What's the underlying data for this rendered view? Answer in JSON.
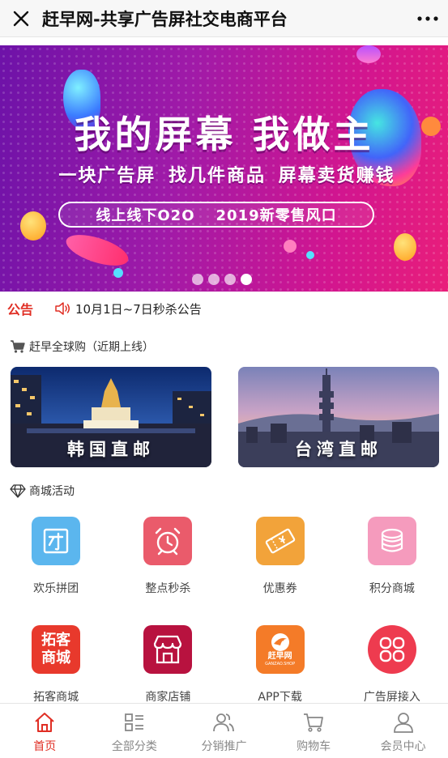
{
  "window": {
    "title": "赶早网-共享广告屏社交电商平台"
  },
  "banner": {
    "headline": "我的屏幕  我做主",
    "subline": "一块广告屏  找几件商品  屏幕卖货赚钱",
    "pill_left": "线上线下O2O",
    "pill_right": "2019新零售风口",
    "slide_count": 4,
    "active_slide": 4
  },
  "notice": {
    "label": "公告",
    "text": "10月1日~7日秒杀公告"
  },
  "global_buy": {
    "title": "赶早全球购（近期上线）",
    "cards": [
      {
        "label": "韩国直邮"
      },
      {
        "label": "台湾直邮"
      }
    ]
  },
  "mall": {
    "title": "商城活动",
    "items": [
      {
        "label": "欢乐拼团",
        "icon": "group-buy-icon",
        "color": "#5bb6ee"
      },
      {
        "label": "整点秒杀",
        "icon": "alarm-clock-icon",
        "color": "#ea5b6b"
      },
      {
        "label": "优惠券",
        "icon": "coupon-icon",
        "color": "#f2a33a"
      },
      {
        "label": "积分商城",
        "icon": "coins-icon",
        "color": "#f59bbd"
      },
      {
        "label": "拓客商城",
        "icon": "tuoke-logo-icon",
        "color": "#e8392c",
        "icon_text": "拓客商城"
      },
      {
        "label": "商家店铺",
        "icon": "store-icon",
        "color": "#b8123f"
      },
      {
        "label": "APP下载",
        "icon": "app-logo-icon",
        "color": "#f47b28",
        "icon_text": "赶早网",
        "icon_subtext": "GANZAO.SHOP"
      },
      {
        "label": "广告屏接入",
        "icon": "grid-icon",
        "color": "#ee3b4f"
      }
    ]
  },
  "tabbar": {
    "active_color": "#e02e24",
    "items": [
      {
        "label": "首页",
        "icon": "home-icon"
      },
      {
        "label": "全部分类",
        "icon": "category-icon"
      },
      {
        "label": "分销推广",
        "icon": "users-icon"
      },
      {
        "label": "购物车",
        "icon": "cart-icon"
      },
      {
        "label": "会员中心",
        "icon": "user-icon"
      }
    ]
  }
}
